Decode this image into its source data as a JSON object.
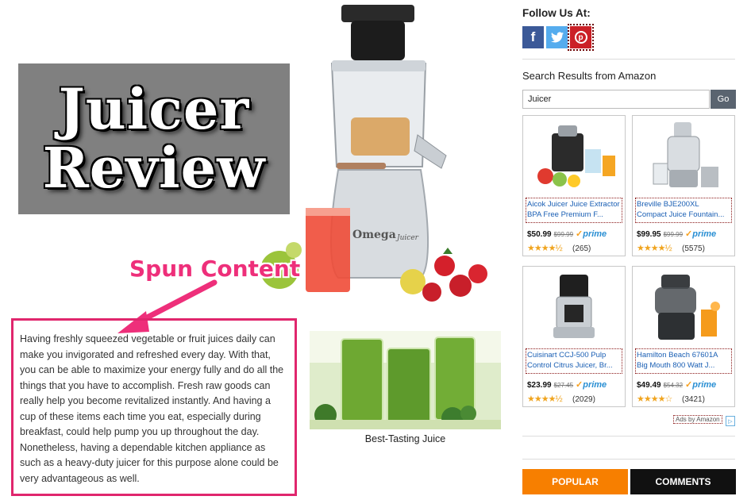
{
  "hero": {
    "title_line1": "Juicer",
    "title_line2": "Review",
    "product_brand": "Omega",
    "product_model": "Juicer"
  },
  "annotation": {
    "label": "Spun Content",
    "color": "#ee2f7a",
    "box_color": "#e0266d"
  },
  "article": {
    "paragraph": "Having freshly squeezed vegetable or fruit juices daily can make you invigorated and refreshed every day. With that, you can be able to maximize your energy fully and do all the things that you have to accomplish. Fresh raw goods can really help you become revitalized instantly. And having a cup of these items each time you eat, especially during breakfast, could help pump you up throughout the day. Nonetheless, having a dependable kitchen appliance as such as a heavy-duty juicer for this purpose alone could be very advantageous as well."
  },
  "juice_image": {
    "caption": "Best-Tasting Juice"
  },
  "sidebar": {
    "follow_title": "Follow Us At:",
    "social": [
      {
        "icon": "facebook-icon",
        "glyph": "f",
        "color": "#3b5998"
      },
      {
        "icon": "twitter-icon",
        "glyph": "🐦",
        "color": "#55acee"
      },
      {
        "icon": "pinterest-icon",
        "glyph": "p",
        "color": "#cb2027"
      }
    ],
    "search_title": "Search Results from Amazon",
    "search": {
      "value": "Juicer",
      "button": "Go"
    },
    "products": [
      {
        "title": "Aicok Juicer Juice Extractor BPA Free Premium F...",
        "price": "$50.99",
        "old_price": "$99.99",
        "prime": "prime",
        "stars": "★★★★½",
        "rating": 4.5,
        "reviews": "(265)"
      },
      {
        "title": "Breville BJE200XL Compact Juice Fountain...",
        "price": "$99.95",
        "old_price": "$99.99",
        "prime": "prime",
        "stars": "★★★★½",
        "rating": 4.5,
        "reviews": "(5575)"
      },
      {
        "title": "Cuisinart CCJ-500 Pulp Control Citrus Juicer, Br...",
        "price": "$23.99",
        "old_price": "$27.45",
        "prime": "prime",
        "stars": "★★★★½",
        "rating": 4.5,
        "reviews": "(2029)"
      },
      {
        "title": "Hamilton Beach 67601A Big Mouth 800 Watt J...",
        "price": "$49.49",
        "old_price": "$54.32",
        "prime": "prime",
        "stars": "★★★★☆",
        "rating": 4.0,
        "reviews": "(3421)"
      }
    ],
    "ads_by": "Ads by Amazon",
    "tabs": {
      "popular": "POPULAR",
      "comments": "COMMENTS"
    }
  }
}
